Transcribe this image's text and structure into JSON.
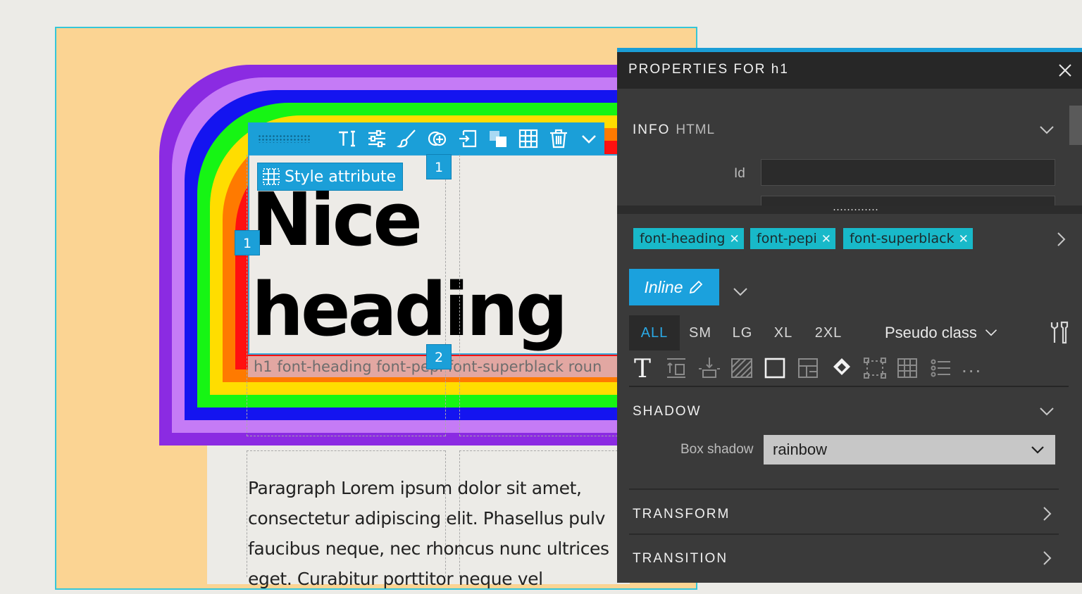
{
  "toolbar": {
    "style_attribute_label": "Style attribute",
    "icons": [
      "text-tool-icon",
      "sliders-icon",
      "brush-icon",
      "add-element-icon",
      "insert-icon",
      "layers-icon",
      "grid-icon",
      "trash-icon",
      "chevron-down-icon"
    ]
  },
  "canvas": {
    "heading_line1": "Nice",
    "heading_line2": "heading",
    "class_strip": "h1 font-heading font-pepi font-superblack roun",
    "paragraph_lines": [
      "Paragraph Lorem ipsum dolor sit amet,",
      "consectetur adipiscing elit. Phasellus pulv",
      "faucibus neque, nec rhoncus nunc ultrices",
      "eget. Curabitur porttitor neque vel"
    ],
    "badges": {
      "top": "1",
      "left": "1",
      "bottom": "2"
    },
    "colors": {
      "rings": [
        "#8b2be2",
        "#c57bf6",
        "#1414f0",
        "#16f514",
        "#ffdd00",
        "#ff7a00",
        "#ff1010"
      ],
      "page_background": "#fbd493",
      "selection": "#1b9fd8"
    }
  },
  "panel": {
    "title": "PROPERTIES FOR h1",
    "info": {
      "title": "INFO",
      "subtitle": "HTML",
      "id_label": "Id",
      "id_value": ""
    },
    "classes": [
      {
        "name": "font-heading"
      },
      {
        "name": "font-pepi"
      },
      {
        "name": "font-superblack"
      }
    ],
    "inline_label": "Inline",
    "breakpoints": [
      "ALL",
      "SM",
      "LG",
      "XL",
      "2XL"
    ],
    "active_breakpoint": "ALL",
    "pseudo_class_label": "Pseudo class",
    "more_label": "...",
    "sections": {
      "shadow": {
        "title": "SHADOW",
        "box_shadow_label": "Box shadow",
        "box_shadow_value": "rainbow"
      },
      "transform": {
        "title": "TRANSFORM"
      },
      "transition": {
        "title": "TRANSITION"
      }
    },
    "accent": "#1a9dd6",
    "chip_color": "#18b9c9"
  }
}
